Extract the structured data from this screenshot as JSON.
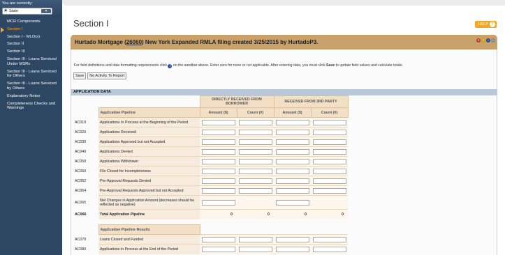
{
  "sidebar": {
    "you_label": "You are currently:",
    "state_value": "State",
    "items": [
      {
        "label": "MCR Components"
      },
      {
        "label": "Section I"
      },
      {
        "label": "Section I - MLO(s)"
      },
      {
        "label": "Section II"
      },
      {
        "label": "Section III"
      },
      {
        "label": "Section III - Loans Serviced Under MSRs"
      },
      {
        "label": "Section III - Loans Serviced for Others"
      },
      {
        "label": "Section III - Loans Serviced by Others"
      },
      {
        "label": "Explanatory Notes"
      },
      {
        "label": "Completeness Checks and Warnings"
      }
    ],
    "active_index": 1
  },
  "page": {
    "title": "Section I",
    "help_label": "HELP",
    "filing_prefix": "Hurtado Mortgage (",
    "filing_link": "26060",
    "filing_suffix": ") New York Expanded RMLA filing created 3/25/2015 by HurtadoP3.",
    "instructions_before": "For field definitions and data formatting requirements click",
    "instructions_after_icon": "on the sandbar above. Enter zero for none or not applicable. After entering data, you must click",
    "instructions_bold": "Save",
    "instructions_end": "to update field values and calculate totals.",
    "save_label": "Save",
    "no_activity_label": "No Activity To Report",
    "section_header": "APPLICATION DATA"
  },
  "table": {
    "group_direct": "DIRECTLY RECEIVED FROM BORROWER",
    "group_third": "RECEIVED FROM 3RD PARTY",
    "pipeline_header": "Application Pipeline",
    "col_amount": "Amount ($)",
    "col_count": "Count (#)",
    "rows": [
      {
        "code": "AC010",
        "desc": "Applications In Process at the Beginning of the Period"
      },
      {
        "code": "AC020",
        "desc": "Applications Received"
      },
      {
        "code": "AC030",
        "desc": "Applications Approved but not Accepted"
      },
      {
        "code": "AC040",
        "desc": "Applications Denied"
      },
      {
        "code": "AC050",
        "desc": "Applications Withdrawn"
      },
      {
        "code": "AC060",
        "desc": "File Closed for Incompleteness"
      },
      {
        "code": "AC062",
        "desc": "Pre-Approval Requests Denied"
      },
      {
        "code": "AC064",
        "desc": "Pre-Approval Requests Approved but not Accepted"
      },
      {
        "code": "AC065",
        "desc": "Net Changes in Application Amount (decreases should be reflected as negative)"
      }
    ],
    "total": {
      "code": "AC066",
      "desc": "Total Application Pipeline",
      "values": [
        "0",
        "0",
        "0",
        "0"
      ]
    },
    "results_header": "Application Pipeline Results",
    "results_rows": [
      {
        "code": "AC070",
        "desc": "Loans Closed and Funded"
      },
      {
        "code": "AC080",
        "desc": "Applications in Process at the End of the Period"
      }
    ]
  },
  "colors": {
    "sidebar_bg": "#2d4662",
    "accent": "#f5a623",
    "filing_bar": "#c9a16b",
    "section_header": "#b8c8d8"
  }
}
